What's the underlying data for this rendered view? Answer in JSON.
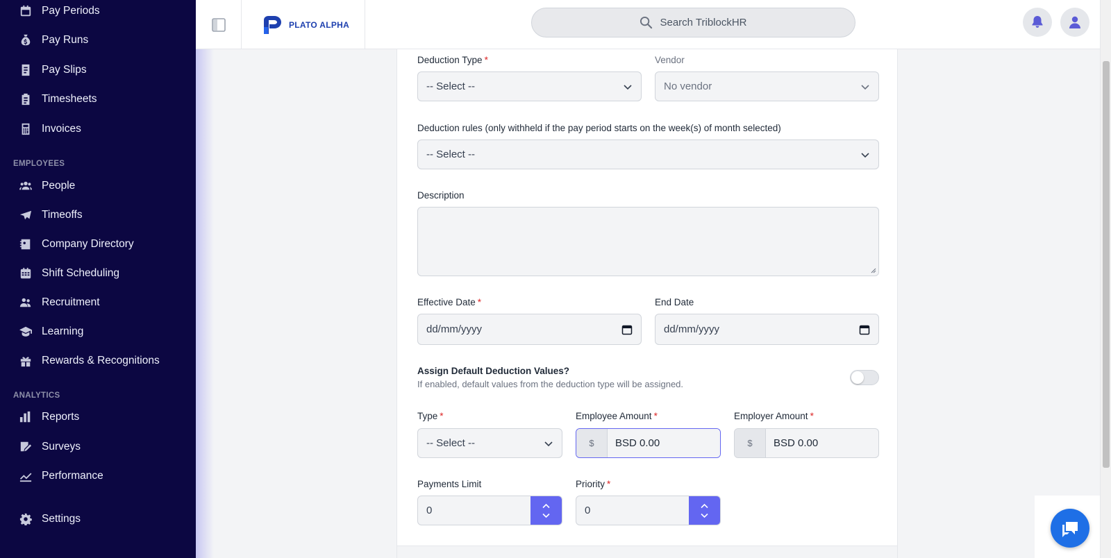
{
  "sidebar": {
    "items": [
      {
        "label": "Pay Periods",
        "icon": "calendar-icon"
      },
      {
        "label": "Pay Runs",
        "icon": "money-bag-icon"
      },
      {
        "label": "Pay Slips",
        "icon": "document-icon"
      },
      {
        "label": "Timesheets",
        "icon": "clipboard-icon"
      },
      {
        "label": "Invoices",
        "icon": "calculator-icon"
      }
    ],
    "employees_section": "EMPLOYEES",
    "employees_items": [
      {
        "label": "People",
        "icon": "people-icon"
      },
      {
        "label": "Timeoffs",
        "icon": "plane-icon"
      },
      {
        "label": "Company Directory",
        "icon": "contact-card-icon"
      },
      {
        "label": "Shift Scheduling",
        "icon": "calendar-grid-icon"
      },
      {
        "label": "Recruitment",
        "icon": "user-group-icon"
      },
      {
        "label": "Learning",
        "icon": "graduation-cap-icon"
      },
      {
        "label": "Rewards & Recognitions",
        "icon": "gift-icon"
      }
    ],
    "analytics_section": "ANALYTICS",
    "analytics_items": [
      {
        "label": "Reports",
        "icon": "bar-chart-icon"
      },
      {
        "label": "Surveys",
        "icon": "survey-icon"
      },
      {
        "label": "Performance",
        "icon": "trend-line-icon"
      }
    ],
    "settings": {
      "label": "Settings",
      "icon": "gear-icon"
    }
  },
  "header": {
    "logo_text": "PLATO ALPHA",
    "search_placeholder": "Search TriblockHR"
  },
  "form": {
    "deduction_type": {
      "label": "Deduction Type",
      "value": "-- Select --"
    },
    "vendor": {
      "label": "Vendor",
      "value": "No vendor"
    },
    "deduction_rules": {
      "label": "Deduction rules (only withheld if the pay period starts on the week(s) of month selected)",
      "value": "-- Select --"
    },
    "description": {
      "label": "Description",
      "value": ""
    },
    "effective_date": {
      "label": "Effective Date",
      "value": "dd/mm/yyyy"
    },
    "end_date": {
      "label": "End Date",
      "value": "dd/mm/yyyy"
    },
    "assign_default": {
      "label": "Assign Default Deduction Values?",
      "help": "If enabled, default values from the deduction type will be assigned.",
      "enabled": false
    },
    "type": {
      "label": "Type",
      "value": "-- Select --"
    },
    "employee_amount": {
      "label": "Employee Amount",
      "prefix": "$",
      "value": "BSD 0.00"
    },
    "employer_amount": {
      "label": "Employer Amount",
      "prefix": "$",
      "value": "BSD 0.00"
    },
    "payments_limit": {
      "label": "Payments Limit",
      "value": "0"
    },
    "priority": {
      "label": "Priority",
      "value": "0"
    },
    "required_marker": "*"
  },
  "colors": {
    "sidebar_bg": "#0c0742",
    "accent": "#6366f1",
    "required": "#dc2626",
    "chat": "#1e6fe6"
  }
}
